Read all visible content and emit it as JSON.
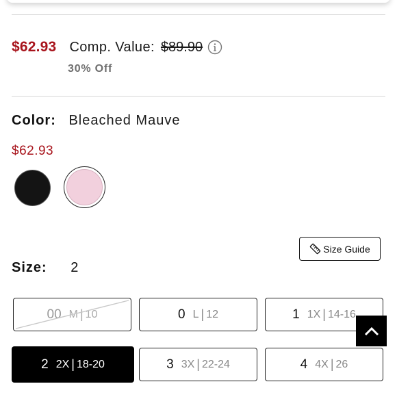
{
  "pricing": {
    "price": "$62.93",
    "comp_label": "Comp. Value:",
    "comp_value": "$89.90",
    "discount": "30% Off"
  },
  "color": {
    "label": "Color:",
    "selected": "Bleached Mauve",
    "swatch_price": "$62.93",
    "swatches": [
      {
        "name": "black",
        "hex": "#141414"
      },
      {
        "name": "Bleached Mauve",
        "hex": "#f2d0dd"
      }
    ]
  },
  "size_guide": {
    "label": "Size Guide",
    "icon": "ruler-icon"
  },
  "size": {
    "label": "Size:",
    "selected": "2",
    "options": [
      {
        "num": "00",
        "alt": "M",
        "us": "10",
        "available": false
      },
      {
        "num": "0",
        "alt": "L",
        "us": "12",
        "available": true
      },
      {
        "num": "1",
        "alt": "1X",
        "us": "14-16",
        "available": true
      },
      {
        "num": "2",
        "alt": "2X",
        "us": "18-20",
        "available": true,
        "selected": true
      },
      {
        "num": "3",
        "alt": "3X",
        "us": "22-24",
        "available": true
      },
      {
        "num": "4",
        "alt": "4X",
        "us": "26",
        "available": true
      }
    ]
  },
  "back_to_top": {
    "icon": "chevron-up-icon"
  },
  "colors": {
    "price_red": "#a8141c",
    "selected_bg": "#000000"
  }
}
